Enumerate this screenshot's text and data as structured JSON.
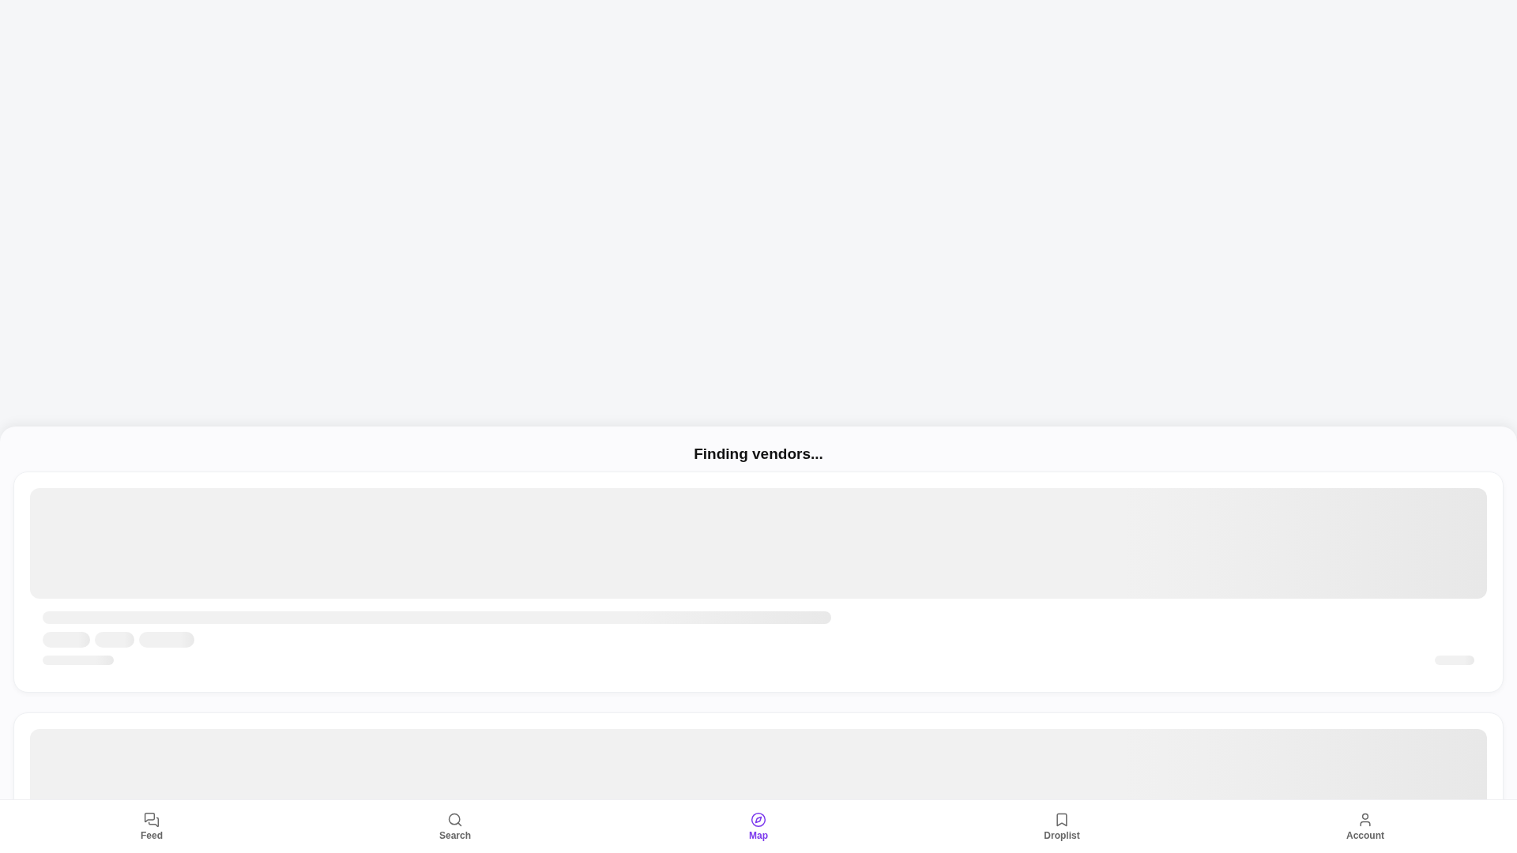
{
  "sheet": {
    "title": "Finding vendors..."
  },
  "tabs": [
    {
      "label": "Feed",
      "kind": "feed",
      "selected": false
    },
    {
      "label": "Search",
      "kind": "search",
      "selected": false
    },
    {
      "label": "Map",
      "kind": "map",
      "selected": true
    },
    {
      "label": "Droplist",
      "kind": "droplist",
      "selected": false
    },
    {
      "label": "Account",
      "kind": "account",
      "selected": false
    }
  ]
}
